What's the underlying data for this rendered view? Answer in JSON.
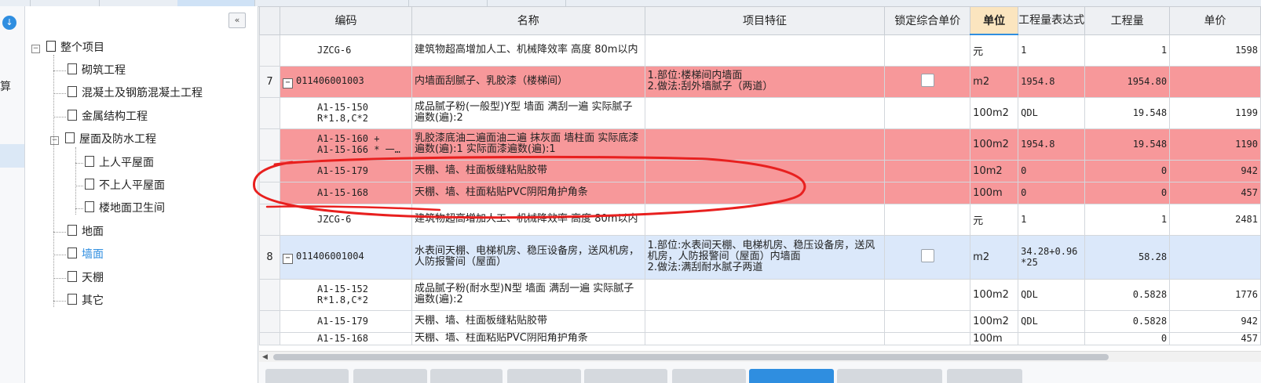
{
  "tree": {
    "collapse_icon": "«",
    "root": "整个项目",
    "items": [
      {
        "label": "砌筑工程",
        "level": 1
      },
      {
        "label": "混凝土及钢筋混凝土工程",
        "level": 1
      },
      {
        "label": "金属结构工程",
        "level": 1
      },
      {
        "label": "屋面及防水工程",
        "level": 1,
        "expanded": true
      },
      {
        "label": "上人平屋面",
        "level": 2
      },
      {
        "label": "不上人平屋面",
        "level": 2
      },
      {
        "label": "楼地面卫生间",
        "level": 2
      },
      {
        "label": "地面",
        "level": 1
      },
      {
        "label": "墙面",
        "level": 1,
        "active": true
      },
      {
        "label": "天棚",
        "level": 1
      },
      {
        "label": "其它",
        "level": 1
      }
    ]
  },
  "rail": {
    "partial_text": "算"
  },
  "columns": [
    "编码",
    "名称",
    "项目特征",
    "锁定综合单价",
    "单位",
    "工程量表达式",
    "工程量",
    "单价"
  ],
  "rows": [
    {
      "idx": "",
      "code": "JZCG-6",
      "name": "建筑物超高增加人工、机械降效率 高度 80m以内",
      "feature": "",
      "lock": false,
      "unit": "元",
      "expr": "1",
      "qty": "1",
      "price": "1598",
      "style": "white",
      "sub": true
    },
    {
      "idx": "7",
      "code": "011406001003",
      "name": "内墙面刮腻子、乳胶漆（楼梯间）",
      "feature": "1.部位:楼梯间内墙面\n2.做法:刮外墙腻子（两道）",
      "lock": true,
      "unit": "m2",
      "expr": "1954.8",
      "qty": "1954.80",
      "price": "",
      "style": "red",
      "sub": false
    },
    {
      "idx": "",
      "code": "A1-15-150\nR*1.8,C*2",
      "name": "成品腻子粉(一般型)Y型 墙面 满刮一遍  实际腻子遍数(遍):2",
      "feature": "",
      "lock": false,
      "unit": "100m2",
      "expr": "QDL",
      "qty": "19.548",
      "price": "1199",
      "style": "white",
      "sub": true
    },
    {
      "idx": "",
      "code": "A1-15-160 +\nA1-15-166 * 一…",
      "name": "乳胶漆底油二遍面油二遍 抹灰面 墙柱面  实际底漆遍数(遍):1  实际面漆遍数(遍):1",
      "feature": "",
      "lock": false,
      "unit": "100m2",
      "expr": "1954.8",
      "qty": "19.548",
      "price": "1190",
      "style": "red",
      "sub": true
    },
    {
      "idx": "",
      "code": "A1-15-179",
      "name": "天棚、墙、柱面板缝粘贴胶带",
      "feature": "",
      "lock": false,
      "unit": "10m2",
      "expr": "0",
      "qty": "0",
      "price": "942",
      "style": "red",
      "sub": true
    },
    {
      "idx": "",
      "code": "A1-15-168",
      "name": "天棚、墙、柱面粘贴PVC阴阳角护角条",
      "feature": "",
      "lock": false,
      "unit": "100m",
      "expr": "0",
      "qty": "0",
      "price": "457",
      "style": "red",
      "sub": true
    },
    {
      "idx": "",
      "code": "JZCG-6",
      "name": "建筑物超高增加人工、机械降效率 高度 80m以内",
      "feature": "",
      "lock": false,
      "unit": "元",
      "expr": "1",
      "qty": "1",
      "price": "2481",
      "style": "white",
      "sub": true
    },
    {
      "idx": "8",
      "code": "011406001004",
      "name": "水表间天棚、电梯机房、稳压设备房，送风机房，人防报警间（屋面）",
      "feature": "1.部位:水表间天棚、电梯机房、稳压设备房，送风机房，人防报警间（屋面）内墙面\n2.做法:满刮耐水腻子两道",
      "lock": true,
      "unit": "m2",
      "expr": "34.28+0.96\n*25",
      "qty": "58.28",
      "price": "",
      "style": "blue",
      "sub": false
    },
    {
      "idx": "",
      "code": "A1-15-152\nR*1.8,C*2",
      "name": "成品腻子粉(耐水型)N型 墙面 满刮一遍  实际腻子遍数(遍):2",
      "feature": "",
      "lock": false,
      "unit": "100m2",
      "expr": "QDL",
      "qty": "0.5828",
      "price": "1776",
      "style": "white",
      "sub": true
    },
    {
      "idx": "",
      "code": "A1-15-179",
      "name": "天棚、墙、柱面板缝粘贴胶带",
      "feature": "",
      "lock": false,
      "unit": "100m2",
      "expr": "QDL",
      "qty": "0.5828",
      "price": "942",
      "style": "white",
      "sub": true
    },
    {
      "idx": "",
      "code": "A1-15-168",
      "name": "天棚、墙、柱面粘贴PVC阴阳角护角条",
      "feature": "",
      "lock": false,
      "unit": "100m",
      "expr": "",
      "qty": "0",
      "price": "457",
      "style": "white",
      "sub": true
    }
  ],
  "colors": {
    "red_row": "#f7989a",
    "blue_row": "#dbe8fa",
    "accent": "#2f8ee0",
    "annotation": "#e8201f"
  }
}
